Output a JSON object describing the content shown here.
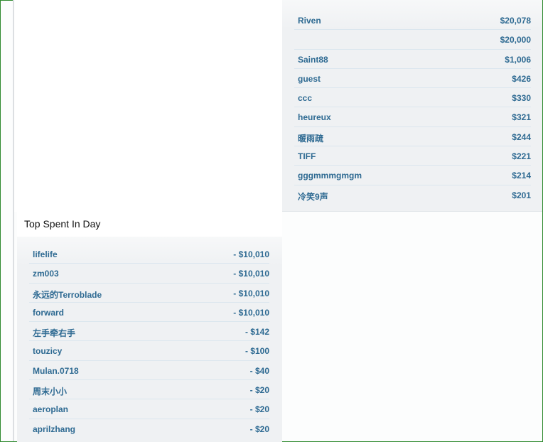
{
  "top_list": [
    {
      "name": "Riven",
      "amount": "$20,078"
    },
    {
      "name": "",
      "amount": "$20,000"
    },
    {
      "name": "Saint88",
      "amount": "$1,006"
    },
    {
      "name": "guest",
      "amount": "$426"
    },
    {
      "name": "ccc",
      "amount": "$330"
    },
    {
      "name": "heureux",
      "amount": "$321"
    },
    {
      "name": "暖雨疏",
      "amount": "$244"
    },
    {
      "name": "TIFF",
      "amount": "$221"
    },
    {
      "name": "gggmmmgmgm",
      "amount": "$214"
    },
    {
      "name": "冷笑9声",
      "amount": "$201"
    }
  ],
  "spent": {
    "title": "Top Spent In Day",
    "rows": [
      {
        "name": "lifelife",
        "amount": "- $10,010"
      },
      {
        "name": "zm003",
        "amount": "- $10,010"
      },
      {
        "name": "永远的Terroblade",
        "amount": "- $10,010"
      },
      {
        "name": "forward",
        "amount": "- $10,010"
      },
      {
        "name": "左手牵右手",
        "amount": "- $142"
      },
      {
        "name": "touzicy",
        "amount": "- $100"
      },
      {
        "name": "Mulan.0718",
        "amount": "- $40"
      },
      {
        "name": "周末小小",
        "amount": "- $20"
      },
      {
        "name": "aeroplan",
        "amount": "- $20"
      },
      {
        "name": "aprilzhang",
        "amount": "- $20"
      }
    ]
  },
  "colors": {
    "frame": "#2e8a2e",
    "link": "#2e6a92",
    "panel": "#eff1f3"
  }
}
